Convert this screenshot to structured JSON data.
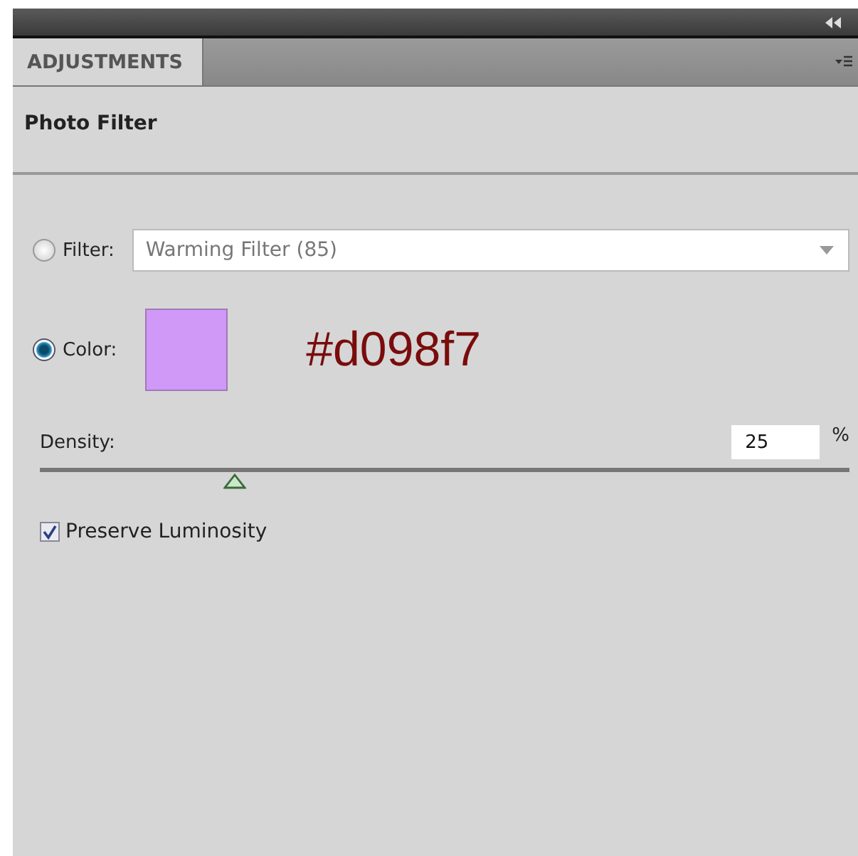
{
  "panel": {
    "tab": {
      "label": "ADJUSTMENTS",
      "selected": true
    },
    "title": "Photo Filter"
  },
  "filter_option": {
    "label": "Filter:",
    "selected": false,
    "dropdown_value": "Warming Filter (85)"
  },
  "color_option": {
    "label": "Color:",
    "selected": true,
    "note": "#d098f7"
  },
  "density": {
    "label": "Density:",
    "value": "25",
    "unit": "%",
    "level": 0.24
  },
  "preserve_luminosity": {
    "label": "Preserve Luminosity",
    "checked": true
  }
}
